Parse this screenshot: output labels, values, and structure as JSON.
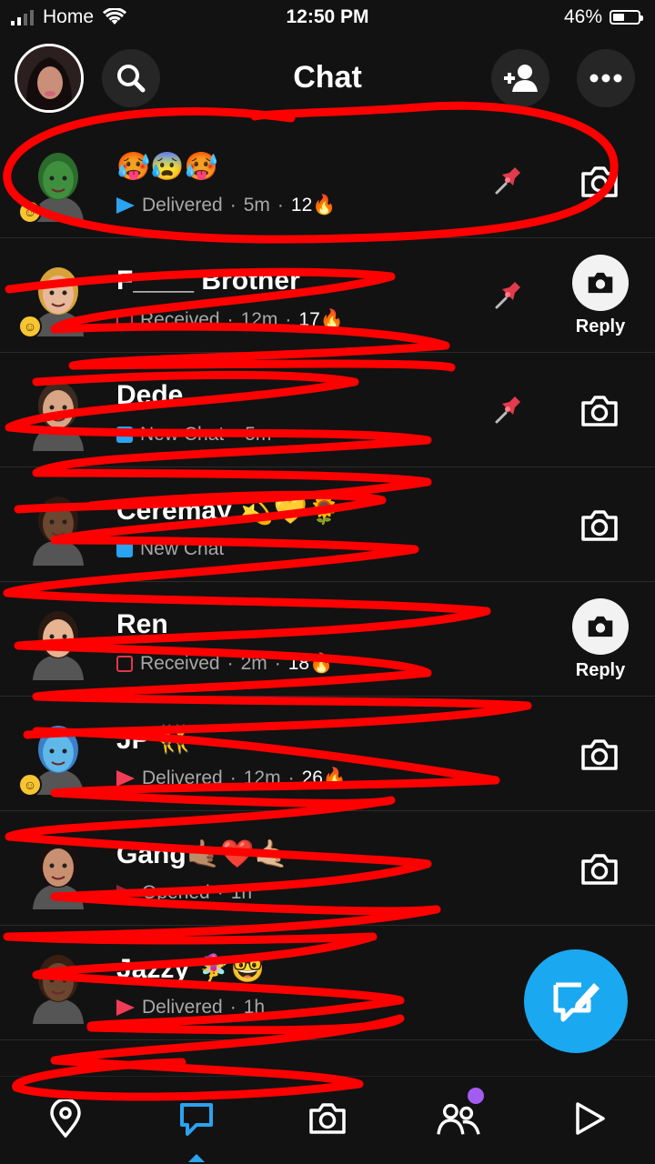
{
  "status_bar": {
    "carrier": "Home",
    "time": "12:50 PM",
    "battery_percent": "46%",
    "battery_level": 0.46,
    "icons": [
      "signal-icon",
      "wifi-icon",
      "battery-icon"
    ]
  },
  "header": {
    "title": "Chat",
    "icons": [
      "avatar",
      "search-icon",
      "add-friend-icon",
      "more-icon"
    ]
  },
  "chats": [
    {
      "name": "🥵😰🥵",
      "status": "Delivered",
      "time": "5m",
      "streak": "12🔥",
      "pinned": true,
      "indicator": "sent-blue",
      "action": "camera"
    },
    {
      "name": "F____ Brother",
      "status": "Received",
      "time": "12m",
      "streak": "17🔥",
      "pinned": true,
      "indicator": "received",
      "action": "reply"
    },
    {
      "name": "Dede",
      "status": "New Chat",
      "time": "5m",
      "streak": "",
      "pinned": true,
      "indicator": "new-snap",
      "action": "camera"
    },
    {
      "name": "Ceremay 💫💛🌻",
      "status": "New Chat",
      "time": "",
      "streak": "",
      "pinned": false,
      "indicator": "new-snap",
      "action": "camera"
    },
    {
      "name": "Ren",
      "status": "Received",
      "time": "2m",
      "streak": "18🔥",
      "pinned": false,
      "indicator": "received",
      "action": "reply"
    },
    {
      "name": "JP 👯",
      "status": "Delivered",
      "time": "12m",
      "streak": "26🔥",
      "pinned": false,
      "indicator": "sent-red",
      "action": "camera"
    },
    {
      "name": "Gang🤙🏽❤️🤙🏼",
      "status": "Opened",
      "time": "1h",
      "streak": "",
      "pinned": false,
      "indicator": "opened",
      "action": "camera"
    },
    {
      "name": "Jazzy 🧚‍♀️🤓",
      "status": "Delivered",
      "time": "1h",
      "streak": "",
      "pinned": false,
      "indicator": "sent-red",
      "action": "none"
    }
  ],
  "reply_label": "Reply",
  "fab": {
    "icon": "new-chat-icon"
  },
  "bottom_nav": {
    "items": [
      "map-icon",
      "chat-icon",
      "camera-icon",
      "stories-icon",
      "spotlight-icon"
    ],
    "active": "chat-icon"
  },
  "colors": {
    "accent": "#2aa3f0",
    "scribble": "#ff0000",
    "fab": "#1aa8f0",
    "received": "#e0364f"
  }
}
